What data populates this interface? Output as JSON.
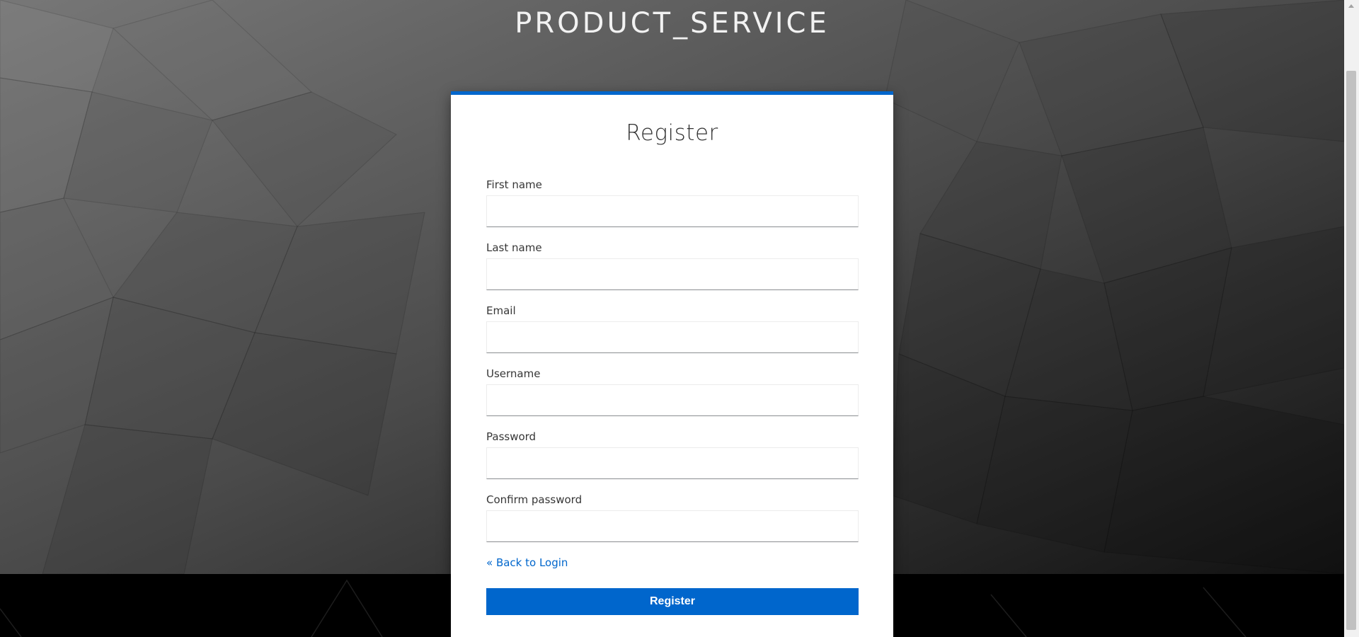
{
  "realm": {
    "title": "PRODUCT_SERVICE"
  },
  "register": {
    "title": "Register",
    "fields": {
      "first_name": {
        "label": "First name",
        "value": ""
      },
      "last_name": {
        "label": "Last name",
        "value": ""
      },
      "email": {
        "label": "Email",
        "value": ""
      },
      "username": {
        "label": "Username",
        "value": ""
      },
      "password": {
        "label": "Password",
        "value": ""
      },
      "confirm_password": {
        "label": "Confirm password",
        "value": ""
      }
    },
    "back_link": "« Back to Login",
    "submit_label": "Register"
  },
  "colors": {
    "accent": "#0066cc",
    "background_dark": "#000000",
    "card": "#ffffff"
  }
}
